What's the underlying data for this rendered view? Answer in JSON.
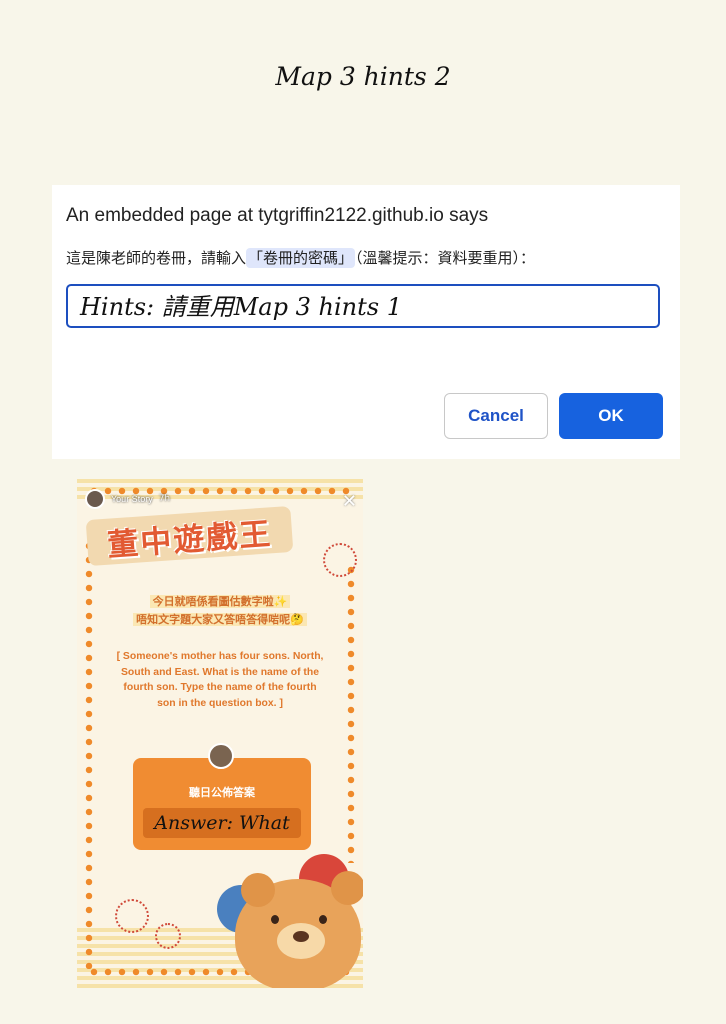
{
  "page": {
    "title": "Map 3 hints 2"
  },
  "dialog": {
    "title": "An embedded page at tytgriffin2122.github.io says",
    "message_before": "這是陳老師的卷冊，請輸入",
    "message_highlight": "「卷冊的密碼」",
    "message_after": "（溫馨提示：資料要重用）：",
    "input_value": "Hints: 請重用Map 3 hints 1",
    "cancel_label": "Cancel",
    "ok_label": "OK"
  },
  "story": {
    "username": "Your Story",
    "time": "7h",
    "banner": "董中遊戲王",
    "subtitle_1": "今日就唔係看圖估數字啦✨",
    "subtitle_2": "唔知文字題大家又答唔答得啱呢🤔",
    "question": "[ Someone's mother has four sons. North, South and East. What is the name of the fourth son. Type the name of the fourth son in the question box. ]",
    "answer_label": "聽日公佈答案",
    "answer_value": "Answer: What",
    "colors": {
      "accent": "#f08c32",
      "dots": "#ef8a2a",
      "title": "#e25a32"
    }
  }
}
